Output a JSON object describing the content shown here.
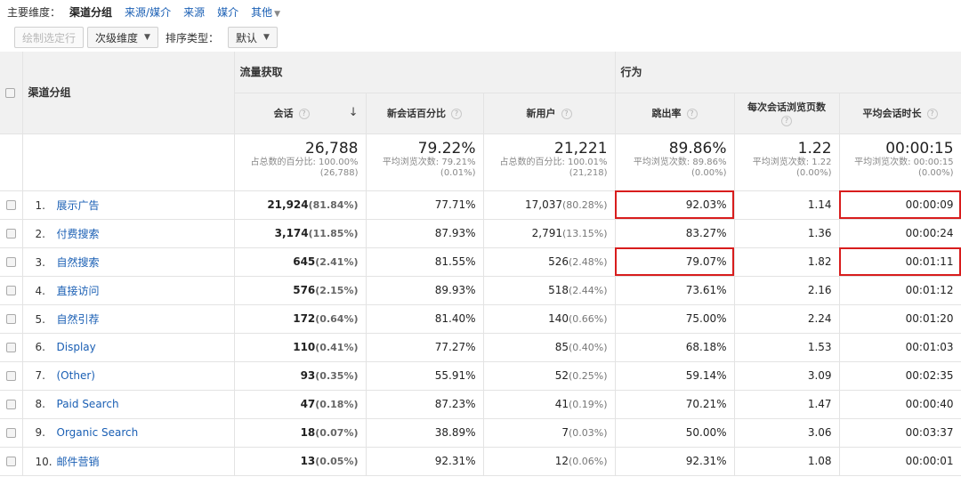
{
  "dimension_bar": {
    "label": "主要维度：",
    "current": "渠道分组",
    "links": [
      "来源/媒介",
      "来源",
      "媒介"
    ],
    "more": "其他"
  },
  "toolbar": {
    "plot_rows": "绘制选定行",
    "secondary_dimension": "次级维度",
    "sort_type_label": "排序类型：",
    "sort_type_value": "默认"
  },
  "header": {
    "channel_group": "渠道分组",
    "acquisition": "流量获取",
    "behavior": "行为",
    "columns": [
      "会话",
      "新会话百分比",
      "新用户",
      "跳出率",
      "每次会话浏览页数",
      "平均会话时长"
    ]
  },
  "totals": {
    "sessions": {
      "value": "26,788",
      "sub1": "占总数的百分比: 100.00%",
      "sub2": "(26,788)"
    },
    "new_sessions": {
      "value": "79.22%",
      "sub1": "平均浏览次数: 79.21%",
      "sub2": "(0.01%)"
    },
    "new_users": {
      "value": "21,221",
      "sub1": "占总数的百分比: 100.01%",
      "sub2": "(21,218)"
    },
    "bounce": {
      "value": "89.86%",
      "sub1": "平均浏览次数: 89.86%",
      "sub2": "(0.00%)"
    },
    "pages": {
      "value": "1.22",
      "sub1": "平均浏览次数: 1.22",
      "sub2": "(0.00%)"
    },
    "duration": {
      "value": "00:00:15",
      "sub1": "平均浏览次数: 00:00:15",
      "sub2": "(0.00%)"
    }
  },
  "rows": [
    {
      "idx": "1.",
      "name": "展示广告",
      "sessions": "21,924",
      "sessions_pct": "(81.84%)",
      "new_sessions": "77.71%",
      "new_users": "17,037",
      "new_users_pct": "(80.28%)",
      "bounce": "92.03%",
      "pages": "1.14",
      "duration": "00:00:09"
    },
    {
      "idx": "2.",
      "name": "付费搜索",
      "sessions": "3,174",
      "sessions_pct": "(11.85%)",
      "new_sessions": "87.93%",
      "new_users": "2,791",
      "new_users_pct": "(13.15%)",
      "bounce": "83.27%",
      "pages": "1.36",
      "duration": "00:00:24"
    },
    {
      "idx": "3.",
      "name": "自然搜索",
      "sessions": "645",
      "sessions_pct": "(2.41%)",
      "new_sessions": "81.55%",
      "new_users": "526",
      "new_users_pct": "(2.48%)",
      "bounce": "79.07%",
      "pages": "1.82",
      "duration": "00:01:11"
    },
    {
      "idx": "4.",
      "name": "直接访问",
      "sessions": "576",
      "sessions_pct": "(2.15%)",
      "new_sessions": "89.93%",
      "new_users": "518",
      "new_users_pct": "(2.44%)",
      "bounce": "73.61%",
      "pages": "2.16",
      "duration": "00:01:12"
    },
    {
      "idx": "5.",
      "name": "自然引荐",
      "sessions": "172",
      "sessions_pct": "(0.64%)",
      "new_sessions": "81.40%",
      "new_users": "140",
      "new_users_pct": "(0.66%)",
      "bounce": "75.00%",
      "pages": "2.24",
      "duration": "00:01:20"
    },
    {
      "idx": "6.",
      "name": "Display",
      "sessions": "110",
      "sessions_pct": "(0.41%)",
      "new_sessions": "77.27%",
      "new_users": "85",
      "new_users_pct": "(0.40%)",
      "bounce": "68.18%",
      "pages": "1.53",
      "duration": "00:01:03"
    },
    {
      "idx": "7.",
      "name": "(Other)",
      "sessions": "93",
      "sessions_pct": "(0.35%)",
      "new_sessions": "55.91%",
      "new_users": "52",
      "new_users_pct": "(0.25%)",
      "bounce": "59.14%",
      "pages": "3.09",
      "duration": "00:02:35"
    },
    {
      "idx": "8.",
      "name": "Paid Search",
      "sessions": "47",
      "sessions_pct": "(0.18%)",
      "new_sessions": "87.23%",
      "new_users": "41",
      "new_users_pct": "(0.19%)",
      "bounce": "70.21%",
      "pages": "1.47",
      "duration": "00:00:40"
    },
    {
      "idx": "9.",
      "name": "Organic Search",
      "sessions": "18",
      "sessions_pct": "(0.07%)",
      "new_sessions": "38.89%",
      "new_users": "7",
      "new_users_pct": "(0.03%)",
      "bounce": "50.00%",
      "pages": "3.06",
      "duration": "00:03:37"
    },
    {
      "idx": "10.",
      "name": "邮件营销",
      "sessions": "13",
      "sessions_pct": "(0.05%)",
      "new_sessions": "92.31%",
      "new_users": "12",
      "new_users_pct": "(0.06%)",
      "bounce": "92.31%",
      "pages": "1.08",
      "duration": "00:00:01"
    }
  ],
  "colors": {
    "link": "#1a5fb4",
    "highlight_box": "#d81d1d",
    "header_bg": "#f1f1f1"
  }
}
